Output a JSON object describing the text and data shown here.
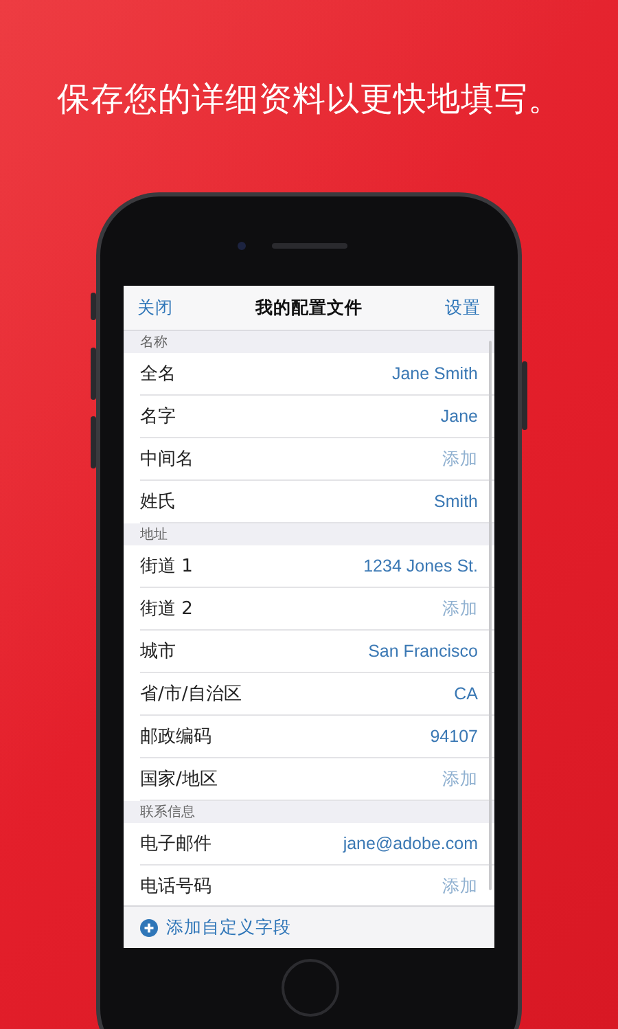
{
  "headline": "保存您的详细资料以更快地填写。",
  "nav": {
    "left": "关闭",
    "title": "我的配置文件",
    "right": "设置"
  },
  "sections": [
    {
      "header": "名称",
      "rows": [
        {
          "label": "全名",
          "value": "Jane Smith"
        },
        {
          "label": "名字",
          "value": "Jane"
        },
        {
          "label": "中间名",
          "placeholder": "添加"
        },
        {
          "label": "姓氏",
          "value": "Smith"
        }
      ]
    },
    {
      "header": "地址",
      "rows": [
        {
          "label": "街道 1",
          "value": "1234 Jones St."
        },
        {
          "label": "街道 2",
          "placeholder": "添加"
        },
        {
          "label": "城市",
          "value": "San Francisco"
        },
        {
          "label": "省/市/自治区",
          "value": "CA"
        },
        {
          "label": "邮政编码",
          "value": "94107"
        },
        {
          "label": "国家/地区",
          "placeholder": "添加"
        }
      ]
    },
    {
      "header": "联系信息",
      "rows": [
        {
          "label": "电子邮件",
          "value": "jane@adobe.com"
        },
        {
          "label": "电话号码",
          "placeholder": "添加"
        }
      ]
    }
  ],
  "toolbar": {
    "action": "添加自定义字段"
  }
}
